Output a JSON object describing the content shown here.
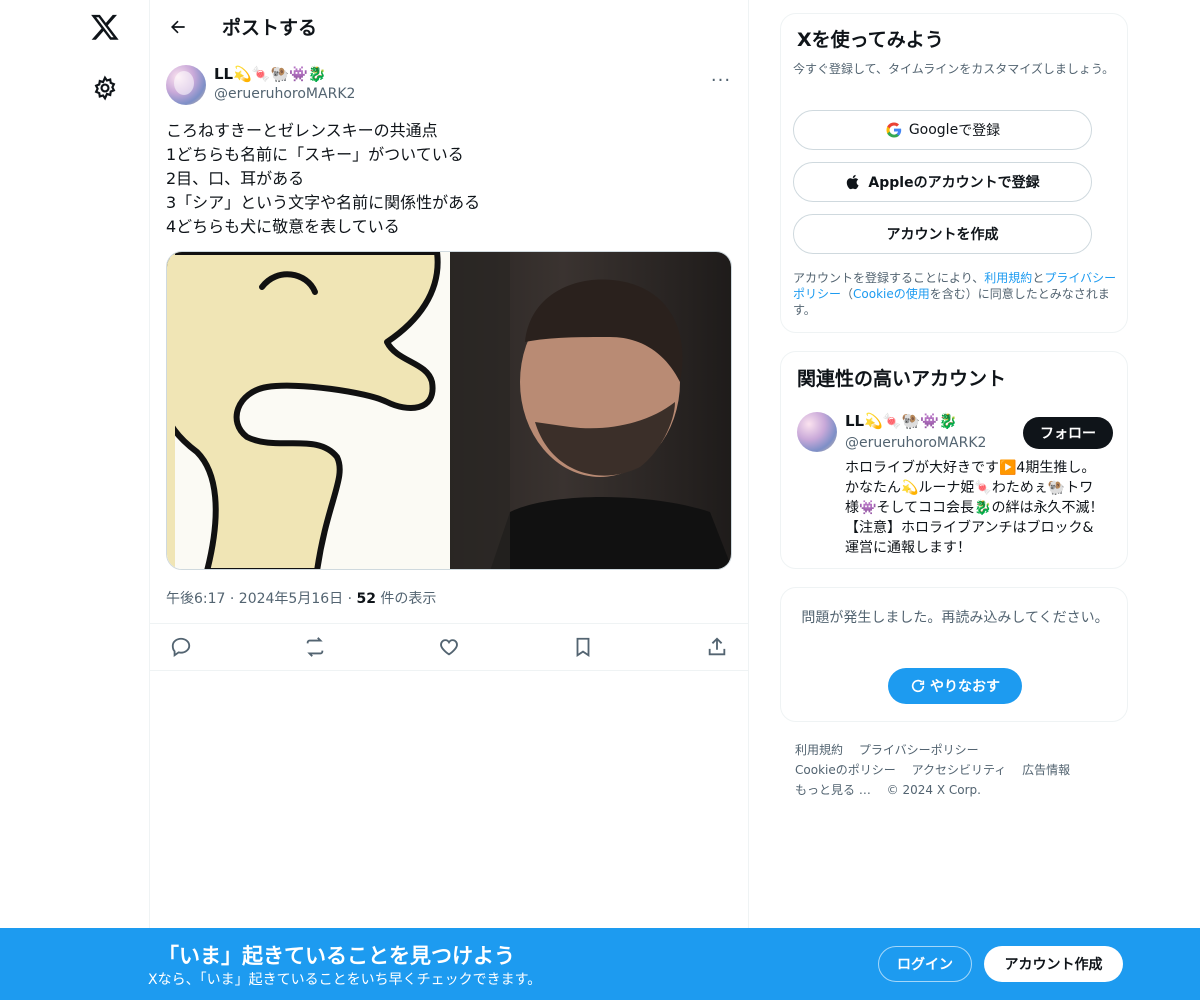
{
  "nav": {
    "logo": "x-logo-icon",
    "settings": "gear-icon"
  },
  "header": {
    "title": "ポストする"
  },
  "post": {
    "name": "LL💫🍬🐏👾🐉",
    "handle": "@erueruhoroMARK2",
    "text": "ころねすきーとゼレンスキーの共通点\n1どちらも名前に「スキー」がついている\n2目、口、耳がある\n3「シア」という文字や名前に関係性がある\n4どちらも犬に敬意を表している",
    "time": "午後6:17 · 2024年5月16日 · ",
    "views_count": "52",
    "views_label": " 件の表示"
  },
  "signup_card": {
    "title": "Xを使ってみよう",
    "subtitle": "今すぐ登録して、タイムラインをカスタマイズしましょう。",
    "google_button_name": "Google",
    "google_button_suffix": " で登録",
    "apple_button": "Appleのアカウントで登録",
    "create_button": "アカウントを作成",
    "legal_prefix": "アカウントを登録することにより、",
    "legal_terms": "利用規約",
    "legal_and": "と",
    "legal_privacy": "プライバシーポリシー",
    "legal_open": "（",
    "legal_cookie": "Cookieの使用",
    "legal_suffix": "を含む）に同意したとみなされます。"
  },
  "relevant": {
    "title": "関連性の高いアカウント",
    "name": "LL💫🍬🐏👾🐉",
    "handle": "@erueruhoroMARK2",
    "follow": "フォロー",
    "bio": "ホロライブが大好きです▶️4期生推し。かなたん💫ルーナ姫🍬わためぇ🐏トワ様👾そしてココ会長🐉の絆は永久不滅！【注意】ホロライブアンチはブロック&運営に通報します！"
  },
  "error_card": {
    "message": "問題が発生しました。再読み込みしてください。",
    "retry": "やりなおす"
  },
  "footer": {
    "links": [
      "利用規約",
      "プライバシーポリシー",
      "Cookieのポリシー",
      "アクセシビリティ",
      "広告情報",
      "もっと見る …",
      "© 2024 X Corp."
    ]
  },
  "banner": {
    "title": "「いま」起きていることを見つけよう",
    "subtitle": "Xなら、「いま」起きていることをいち早くチェックできます。",
    "login": "ログイン",
    "signup": "アカウント作成"
  },
  "colors": {
    "accent": "#1d9bf0",
    "text": "#0f1419",
    "muted": "#536471",
    "border": "#eff3f4"
  }
}
